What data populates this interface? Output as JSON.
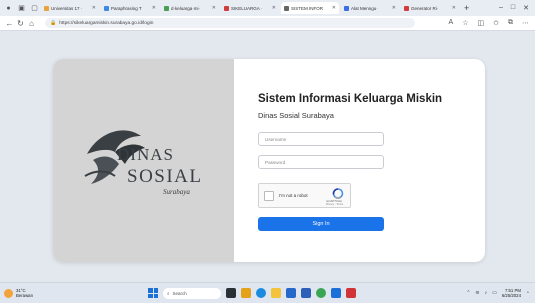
{
  "browser": {
    "tabs": [
      {
        "label": "Universitas 17 ·",
        "favicon_color": "#e8a33c",
        "active": false
      },
      {
        "label": "Paraphrasing T",
        "favicon_color": "#3c8ae8",
        "active": false
      },
      {
        "label": "d·keluarga·mi·",
        "favicon_color": "#4b9e56",
        "active": false
      },
      {
        "label": "SIKELUARGA ·",
        "favicon_color": "#d33c3c",
        "active": false
      },
      {
        "label": "SISTEM INFOR",
        "favicon_color": "#666666",
        "active": true
      },
      {
        "label": "Alat Menngu·",
        "favicon_color": "#3c6ee8",
        "active": false
      },
      {
        "label": "Generator Ri·",
        "favicon_color": "#d33c3c",
        "active": false
      }
    ],
    "new_tab": "+",
    "window_controls": {
      "minimize": "–",
      "maximize": "□",
      "close": "✕"
    },
    "url": "https://sikeluargamiskin.surabaya.go.id/login"
  },
  "login": {
    "logo_text_line1": "DINAS",
    "logo_text_line2": "SOSIAL",
    "logo_script": "Surabaya",
    "title": "Sistem Informasi Keluarga Miskin",
    "subtitle": "Dinas Sosial Surabaya",
    "username_placeholder": "Username",
    "password_placeholder": "Password",
    "captcha_label": "I'm not a robot",
    "captcha_brand": "reCAPTCHA",
    "captcha_terms": "Privacy - Terms",
    "signin_label": "Sign In"
  },
  "taskbar": {
    "weather_temp": "31°C",
    "weather_desc": "Berawan",
    "search_placeholder": "Search",
    "time": "7:51 PM",
    "date": "6/25/2024"
  },
  "colors": {
    "accent": "#1a73e8",
    "left_panel": "#d4d4d4",
    "page_bg": "#e3e8ee"
  }
}
